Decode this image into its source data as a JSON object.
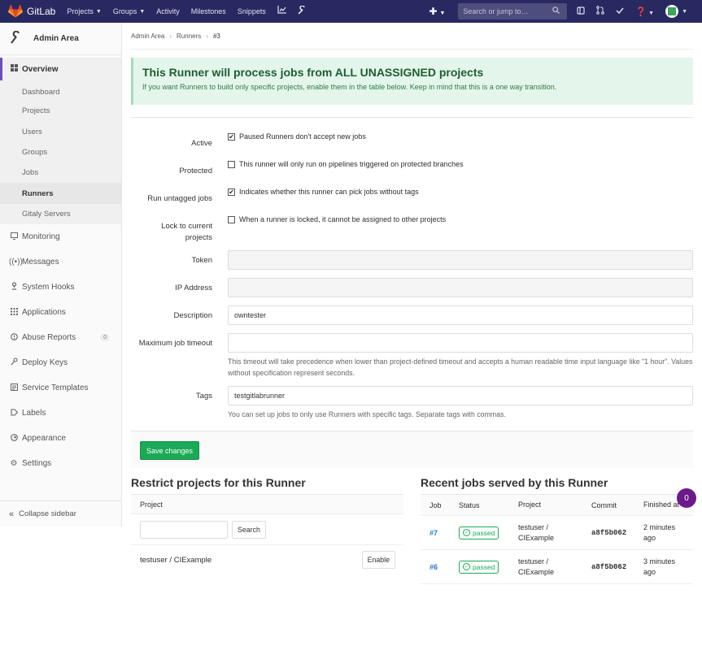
{
  "navbar": {
    "brand": "GitLab",
    "links": [
      {
        "label": "Projects",
        "caret": true
      },
      {
        "label": "Groups",
        "caret": true
      },
      {
        "label": "Activity",
        "caret": false
      },
      {
        "label": "Milestones",
        "caret": false
      },
      {
        "label": "Snippets",
        "caret": false
      }
    ],
    "search_placeholder": "Search or jump to…"
  },
  "sidebar": {
    "title": "Admin Area",
    "overview": "Overview",
    "sub_items": [
      "Dashboard",
      "Projects",
      "Users",
      "Groups",
      "Jobs",
      "Runners",
      "Gitaly Servers"
    ],
    "items": [
      {
        "label": "Monitoring",
        "icon": "monitor-icon"
      },
      {
        "label": "Messages",
        "icon": "broadcast-icon"
      },
      {
        "label": "System Hooks",
        "icon": "hook-icon"
      },
      {
        "label": "Applications",
        "icon": "grid-icon"
      },
      {
        "label": "Abuse Reports",
        "icon": "warning-icon",
        "badge": "0"
      },
      {
        "label": "Deploy Keys",
        "icon": "key-icon"
      },
      {
        "label": "Service Templates",
        "icon": "template-icon"
      },
      {
        "label": "Labels",
        "icon": "label-icon"
      },
      {
        "label": "Appearance",
        "icon": "appearance-icon"
      },
      {
        "label": "Settings",
        "icon": "gear-icon"
      }
    ],
    "collapse": "Collapse sidebar"
  },
  "breadcrumb": [
    "Admin Area",
    "Runners",
    "#3"
  ],
  "alert": {
    "title": "This Runner will process jobs from ALL UNASSIGNED projects",
    "text": "If you want Runners to build only specific projects, enable them in the table below. Keep in mind that this is a one way transition."
  },
  "form": {
    "active": {
      "label": "Active",
      "text": "Paused Runners don't accept new jobs",
      "checked": true
    },
    "protected": {
      "label": "Protected",
      "text": "This runner will only run on pipelines triggered on protected branches",
      "checked": false
    },
    "untagged": {
      "label": "Run untagged jobs",
      "text": "Indicates whether this runner can pick jobs without tags",
      "checked": true
    },
    "locked": {
      "label_line1": "Lock to current",
      "label_line2": "projects",
      "text": "When a runner is locked, it cannot be assigned to other projects",
      "checked": false
    },
    "token": {
      "label": "Token",
      "value": ""
    },
    "ip": {
      "label": "IP Address",
      "value": ""
    },
    "description": {
      "label": "Description",
      "value": "owntester"
    },
    "timeout": {
      "label": "Maximum job timeout",
      "value": "",
      "help": "This timeout will take precedence when lower than project-defined timeout and accepts a human readable time input language like \"1 hour\". Values without specification represent seconds."
    },
    "tags": {
      "label": "Tags",
      "value": "testgitlabrunner",
      "help": "You can set up jobs to only use Runners with specific tags. Separate tags with commas."
    },
    "save": "Save changes"
  },
  "restrict": {
    "title": "Restrict projects for this Runner",
    "col": "Project",
    "search_btn": "Search",
    "project": "testuser / CIExample",
    "enable_btn": "Enable"
  },
  "recent": {
    "title": "Recent jobs served by this Runner",
    "cols": [
      "Job",
      "Status",
      "Project",
      "Commit",
      "Finished at"
    ],
    "rows": [
      {
        "job": "#7",
        "status": "passed",
        "project_l1": "testuser /",
        "project_l2": "CIExample",
        "commit": "a8f5b062",
        "fin_l1": "2 minutes",
        "fin_l2": "ago"
      },
      {
        "job": "#6",
        "status": "passed",
        "project_l1": "testuser /",
        "project_l2": "CIExample",
        "commit": "a8f5b062",
        "fin_l1": "3 minutes",
        "fin_l2": "ago"
      }
    ]
  },
  "fab_count": "0",
  "colors": {
    "navbar": "#292961",
    "success": "#1aaa55",
    "link": "#1f78d1",
    "alert_bg": "#e4f5eb"
  }
}
